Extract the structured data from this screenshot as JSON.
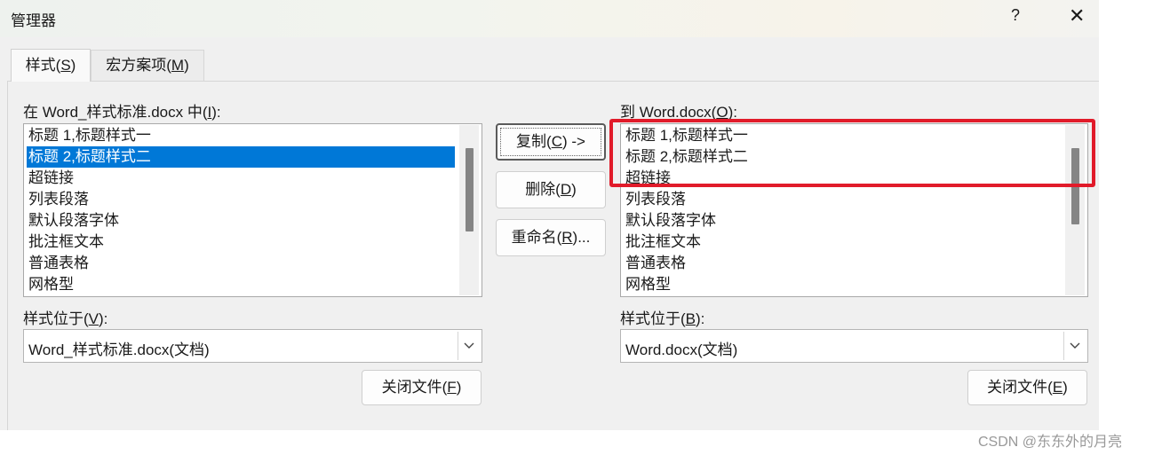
{
  "window": {
    "title": "管理器",
    "help": "?",
    "close": "✕"
  },
  "tabs": [
    {
      "label": "样式(",
      "mnemonic": "S",
      "suffix": ")"
    },
    {
      "label": "宏方案项(",
      "mnemonic": "M",
      "suffix": ")"
    }
  ],
  "left_panel": {
    "label_pre": "在 Word_样式标准.docx 中(",
    "label_mn": "I",
    "label_post": "):",
    "items": [
      "标题 1,标题样式一",
      "标题 2,标题样式二",
      "超链接",
      "列表段落",
      "默认段落字体",
      "批注框文本",
      "普通表格",
      "网格型"
    ],
    "selected_index": 1,
    "location_label_pre": "样式位于(",
    "location_label_mn": "V",
    "location_label_post": "):",
    "location_value": "Word_样式标准.docx(文档)",
    "close_file_pre": "关闭文件(",
    "close_file_mn": "F",
    "close_file_post": ")"
  },
  "middle": {
    "copy_pre": "复制(",
    "copy_mn": "C",
    "copy_post": ") ->",
    "delete_pre": "删除(",
    "delete_mn": "D",
    "delete_post": ")",
    "rename_pre": "重命名(",
    "rename_mn": "R",
    "rename_post": ")..."
  },
  "right_panel": {
    "label_pre": "到 Word.docx(",
    "label_mn": "O",
    "label_post": "):",
    "items": [
      "标题 1,标题样式一",
      "标题 2,标题样式二",
      "超链接",
      "列表段落",
      "默认段落字体",
      "批注框文本",
      "普通表格",
      "网格型"
    ],
    "location_label_pre": "样式位于(",
    "location_label_mn": "B",
    "location_label_post": "):",
    "location_value": "Word.docx(文档)",
    "close_file_pre": "关闭文件(",
    "close_file_mn": "E",
    "close_file_post": ")"
  },
  "watermark": "CSDN @东东外的月亮",
  "colors": {
    "selection": "#0078d7",
    "highlight_box": "#e11b2a"
  }
}
